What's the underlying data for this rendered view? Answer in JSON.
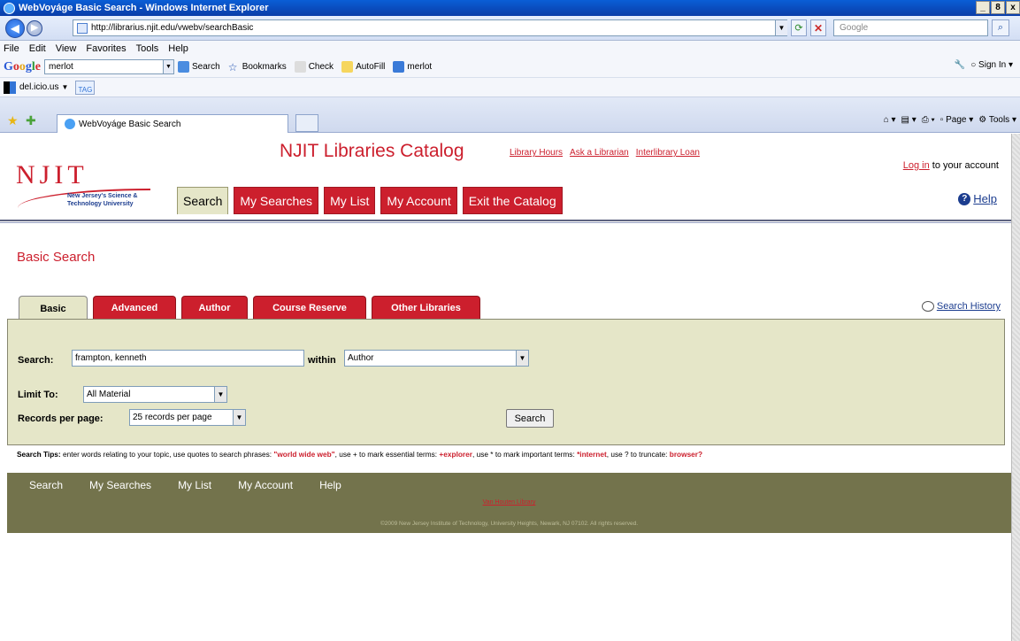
{
  "window": {
    "title": "WebVoyáge Basic Search - Windows Internet Explorer",
    "min": "_",
    "max": "8",
    "close": "x"
  },
  "address": {
    "url": "http://librarius.njit.edu/vwebv/searchBasic",
    "search_placeholder": "Google"
  },
  "menu": [
    "File",
    "Edit",
    "View",
    "Favorites",
    "Tools",
    "Help"
  ],
  "google_toolbar": {
    "query": "merlot",
    "items": [
      "Search",
      "Bookmarks",
      "Check",
      "AutoFill",
      "merlot"
    ],
    "sign_in": "Sign In"
  },
  "delicious": {
    "label": "del.icio.us",
    "tag": "TAG"
  },
  "ie_tab": {
    "title": "WebVoyáge Basic Search",
    "page": "Page",
    "tools": "Tools"
  },
  "site": {
    "catalog_title": "NJIT Libraries Catalog",
    "top_links": [
      "Library Hours",
      "Ask a Librarian",
      "Interlibrary Loan"
    ],
    "login_link": "Log in",
    "login_text": " to your account",
    "help": "Help",
    "logo_letters": "NJIT",
    "logo_sub_1": "New Jersey's Science &",
    "logo_sub_2": "Technology University",
    "nav": [
      "Search",
      "My Searches",
      "My List",
      "My Account",
      "Exit the Catalog"
    ]
  },
  "page": {
    "heading": "Basic Search",
    "tabs": [
      "Basic",
      "Advanced",
      "Author",
      "Course Reserve",
      "Other Libraries"
    ],
    "search_history": "Search History"
  },
  "form": {
    "search_label": "Search:",
    "search_value": "frampton, kenneth",
    "within_label": "within",
    "within_value": "Author",
    "limit_label": "Limit To:",
    "limit_value": "All Material",
    "records_label": "Records per page:",
    "records_value": "25 records per page",
    "search_button": "Search"
  },
  "tips": {
    "label": "Search Tips:",
    "t1": " enter words relating to your topic, use quotes to search phrases: ",
    "e1": "\"world wide web\"",
    "t2": ", use + to mark essential terms: ",
    "e2": "+explorer",
    "t3": ", use * to mark important terms: ",
    "e3": "*internet",
    "t4": ", use ? to truncate: ",
    "e4": "browser?"
  },
  "footer": {
    "nav": [
      "Search",
      "My Searches",
      "My List",
      "My Account",
      "Help"
    ],
    "library_link": "Van Houten Library",
    "copyright": "©2009 New Jersey Institute of Technology, University Heights, Newark, NJ 07102. All rights reserved."
  }
}
